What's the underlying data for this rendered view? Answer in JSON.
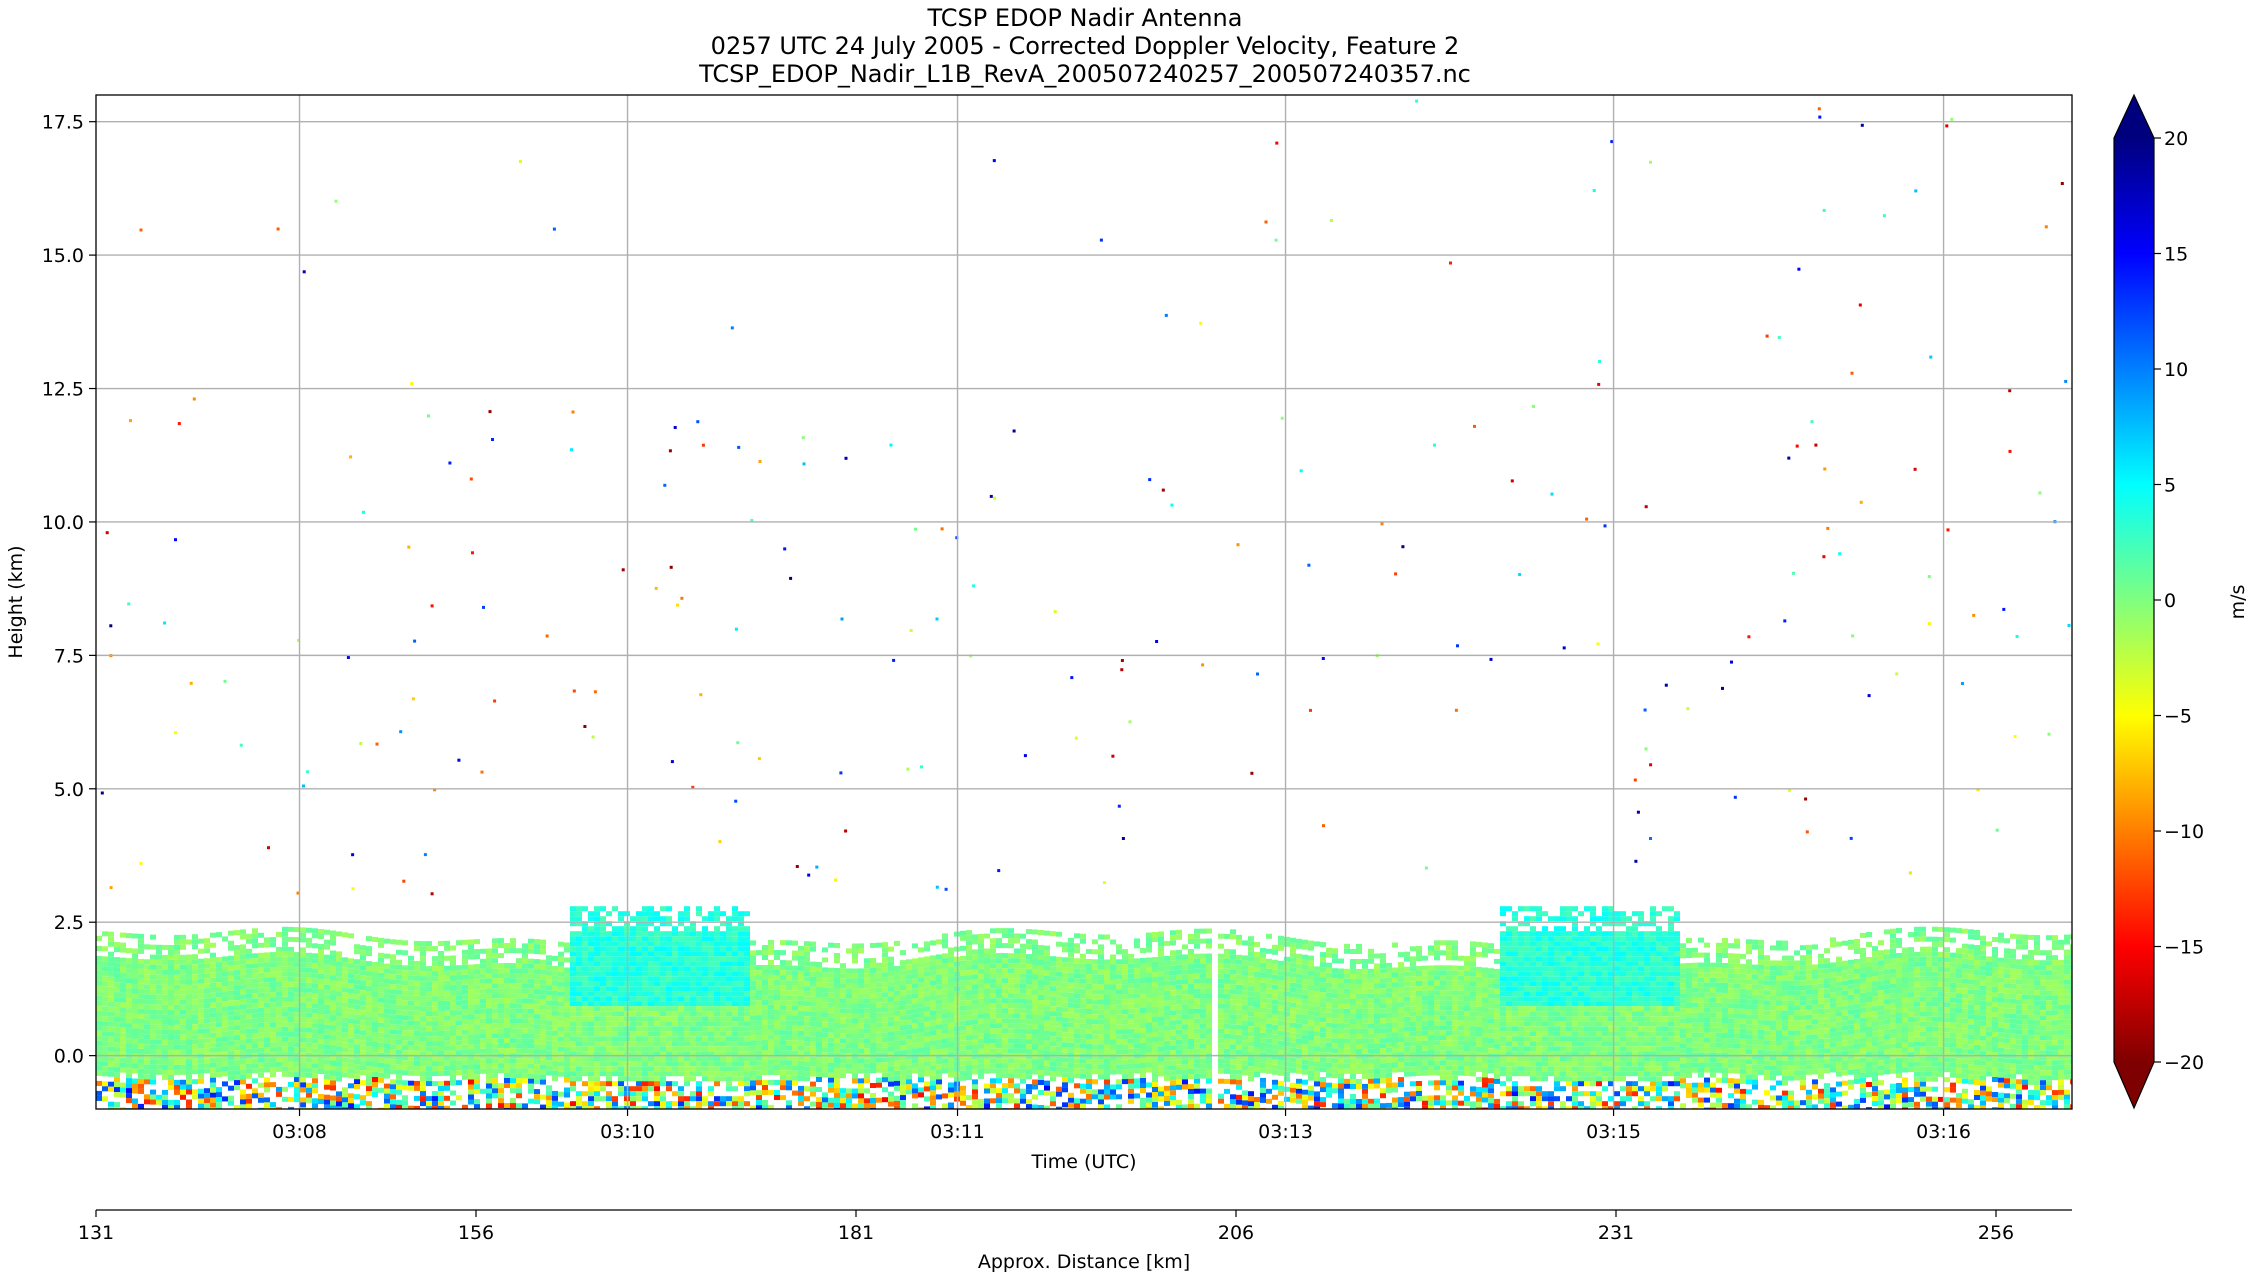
{
  "chart_data": {
    "type": "heatmap",
    "title_lines": [
      "TCSP EDOP Nadir Antenna",
      "0257 UTC 24 July 2005 - Corrected Doppler Velocity, Feature 2",
      "TCSP_EDOP_Nadir_L1B_RevA_200507240257_200507240357.nc"
    ],
    "xlabel": "Time (UTC)",
    "ylabel": "Height (km)",
    "x2label": "Approx. Distance [km]",
    "x_time_ticks": [
      "03:08",
      "03:10",
      "03:11",
      "03:13",
      "03:15",
      "03:16"
    ],
    "x_time_tick_pos": [
      0.103,
      0.269,
      0.436,
      0.602,
      0.768,
      0.935
    ],
    "x_distance_ticks": [
      131,
      156,
      181,
      206,
      231,
      256
    ],
    "x_distance_range": [
      131,
      261
    ],
    "ylim": [
      -1.0,
      18.0
    ],
    "y_ticks": [
      0.0,
      2.5,
      5.0,
      7.5,
      10.0,
      12.5,
      15.0,
      17.5
    ],
    "y_tick_labels": [
      "0.0",
      "2.5",
      "5.0",
      "7.5",
      "10.0",
      "12.5",
      "15.0",
      "17.5"
    ],
    "grid": true,
    "colorbar": {
      "label": "m/s",
      "range": [
        -20,
        20
      ],
      "ticks": [
        20,
        15,
        10,
        5,
        0,
        -5,
        -10,
        -15,
        -20
      ],
      "tick_labels": [
        "20",
        "15",
        "10",
        "5",
        "0",
        "−5",
        "−10",
        "−15",
        "−20"
      ],
      "colormap": "jet_r",
      "extend": "both",
      "colors": [
        "#00007f",
        "#0000ff",
        "#007fff",
        "#00ffff",
        "#7fff7f",
        "#ffff00",
        "#ff7f00",
        "#ff0000",
        "#7f0000"
      ]
    },
    "data_gap_distance_km": 204.5,
    "echo_layer": {
      "base_km": -1.0,
      "top_km_typical": 2.2,
      "updraft_tops": [
        {
          "distance_km": 168,
          "top_km": 2.8
        },
        {
          "distance_km": 229,
          "top_km": 2.8
        }
      ],
      "dominant_velocity_ms": 0
    }
  }
}
